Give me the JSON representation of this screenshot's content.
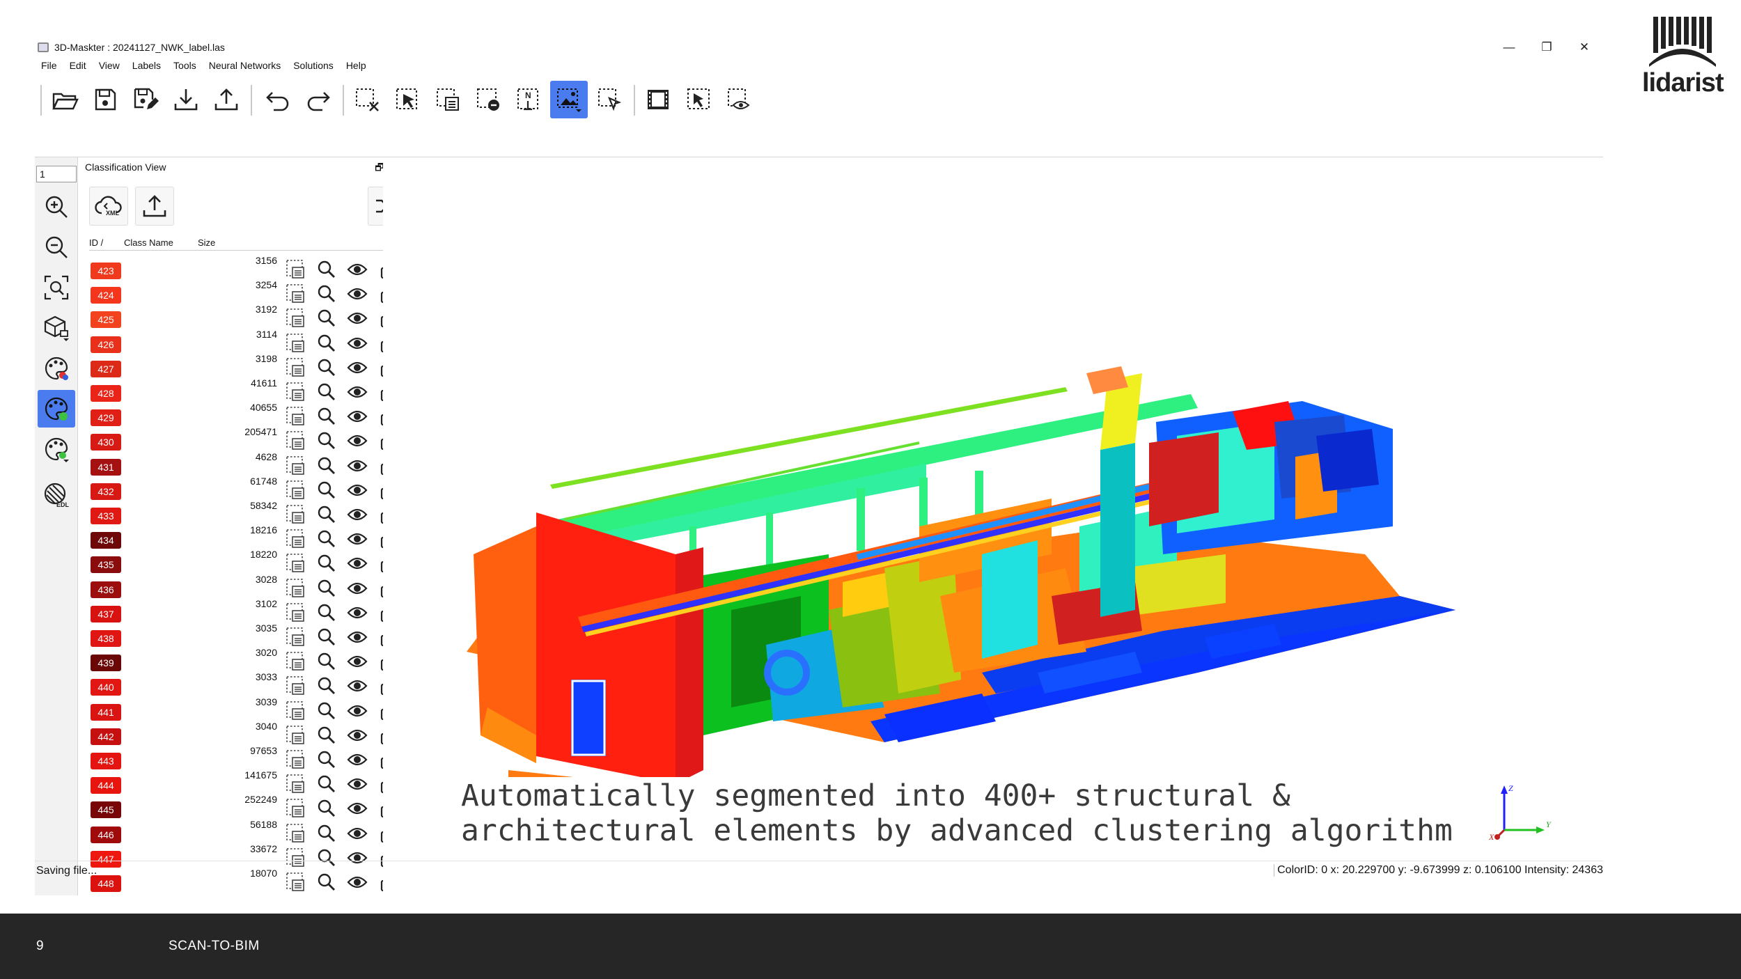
{
  "window": {
    "title": "3D-Maskter : 20241127_NWK_label.las",
    "controls": [
      "—",
      "❐",
      "✕"
    ]
  },
  "menu": [
    "File",
    "Edit",
    "View",
    "Labels",
    "Tools",
    "Neural Networks",
    "Solutions",
    "Help"
  ],
  "toolbar": {
    "buttons": [
      "open-folder",
      "save",
      "save-as",
      "import",
      "export",
      "undo",
      "redo",
      "clear-selection",
      "select-points",
      "select-list",
      "select-remove",
      "normal-select",
      "polygon-select",
      "cursor-select",
      "film",
      "segment",
      "visibility"
    ],
    "active": "polygon-select"
  },
  "left_tools": {
    "spin_value": "1",
    "buttons": [
      "zoom-in",
      "zoom-out",
      "zoom-fit",
      "box-view",
      "palette-color",
      "palette-segment",
      "palette-intensity",
      "edl"
    ],
    "active": "palette-segment"
  },
  "panel": {
    "title": "Classification View",
    "controls": "🗗 ✕",
    "xml_label": "XML",
    "columns": [
      "ID",
      "Class Name",
      "Size"
    ],
    "rows": [
      {
        "id": "423",
        "size": "3156",
        "color": "#f03a1e"
      },
      {
        "id": "424",
        "size": "3254",
        "color": "#f3361c"
      },
      {
        "id": "425",
        "size": "3192",
        "color": "#f2421e"
      },
      {
        "id": "426",
        "size": "3114",
        "color": "#e9301a"
      },
      {
        "id": "427",
        "size": "3198",
        "color": "#dd2a18"
      },
      {
        "id": "428",
        "size": "41611",
        "color": "#ea2418"
      },
      {
        "id": "429",
        "size": "40655",
        "color": "#e02016"
      },
      {
        "id": "430",
        "size": "205471",
        "color": "#d81a14"
      },
      {
        "id": "431",
        "size": "4628",
        "color": "#a51010"
      },
      {
        "id": "432",
        "size": "61748",
        "color": "#d81812"
      },
      {
        "id": "433",
        "size": "58342",
        "color": "#e01a12"
      },
      {
        "id": "434",
        "size": "18216",
        "color": "#6e0808"
      },
      {
        "id": "435",
        "size": "18220",
        "color": "#8a0c0c"
      },
      {
        "id": "436",
        "size": "3028",
        "color": "#9c0e0e"
      },
      {
        "id": "437",
        "size": "3102",
        "color": "#d81210"
      },
      {
        "id": "438",
        "size": "3035",
        "color": "#e01612"
      },
      {
        "id": "439",
        "size": "3020",
        "color": "#6a0606"
      },
      {
        "id": "440",
        "size": "3033",
        "color": "#e21612"
      },
      {
        "id": "441",
        "size": "3039",
        "color": "#d91412"
      },
      {
        "id": "442",
        "size": "3040",
        "color": "#c61010"
      },
      {
        "id": "443",
        "size": "97653",
        "color": "#e41410"
      },
      {
        "id": "444",
        "size": "141675",
        "color": "#e8140e"
      },
      {
        "id": "445",
        "size": "252249",
        "color": "#780606"
      },
      {
        "id": "446",
        "size": "56188",
        "color": "#a00a0a"
      },
      {
        "id": "447",
        "size": "33672",
        "color": "#ee1810"
      },
      {
        "id": "448",
        "size": "18070",
        "color": "#dc120e"
      }
    ]
  },
  "viewport": {
    "caption_line1": "Automatically segmented into 400+ structural &",
    "caption_line2": "architectural elements by advanced clustering algorithm",
    "axis_labels": [
      "Z",
      "Y",
      "X"
    ]
  },
  "status": {
    "left": "Saving file...",
    "right": "ColorID: 0 x: 20.229700 y: -9.673999 z: 0.106100 Intensity: 24363"
  },
  "brand": {
    "name": "lidarist"
  },
  "footer": {
    "page_number": "9",
    "title": "SCAN-TO-BIM"
  }
}
